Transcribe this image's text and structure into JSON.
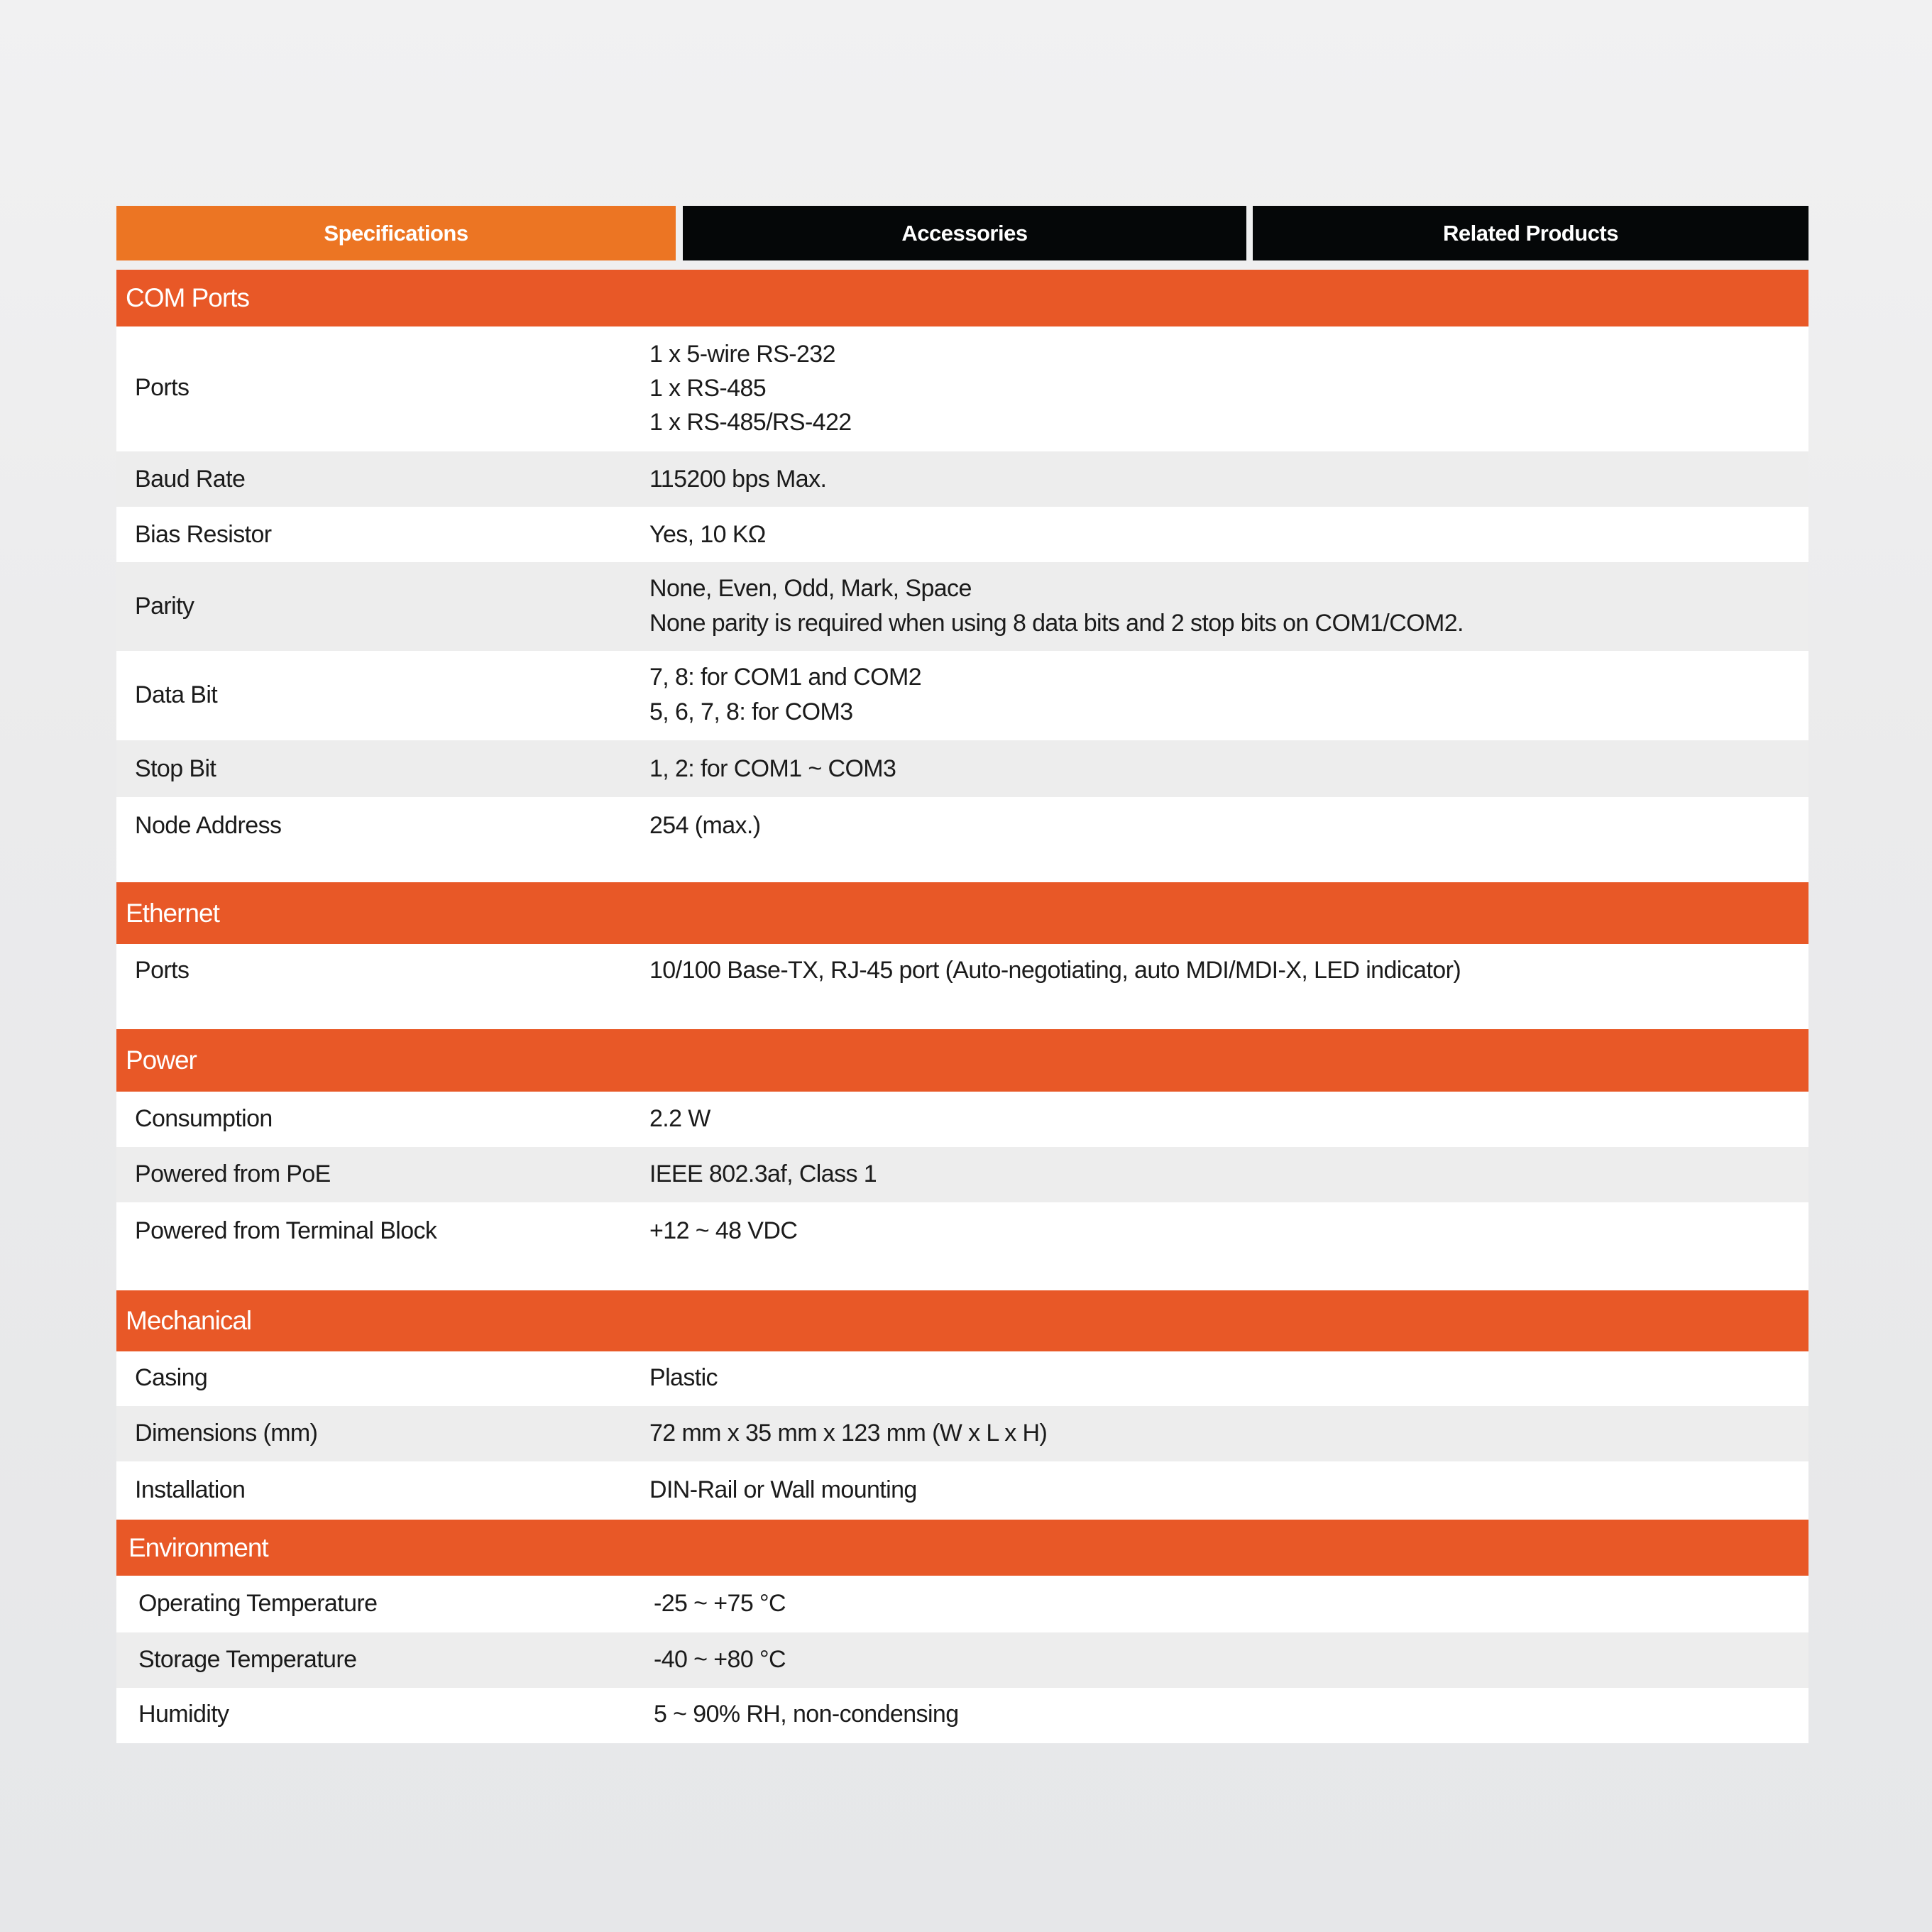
{
  "tabs": [
    {
      "label": "Specifications",
      "active": true
    },
    {
      "label": "Accessories",
      "active": false
    },
    {
      "label": "Related Products",
      "active": false
    }
  ],
  "colors": {
    "active_tab": "#ec7523",
    "inactive_tab": "#050708",
    "section_header": "#e85827",
    "row_alt": "#ededed"
  },
  "sections": {
    "com_ports": {
      "title": "COM Ports",
      "rows": [
        {
          "label": "Ports",
          "value": [
            "1 x 5-wire RS-232",
            "1 x RS-485",
            "1 x RS-485/RS-422"
          ]
        },
        {
          "label": "Baud Rate",
          "value": [
            "115200 bps Max."
          ]
        },
        {
          "label": "Bias Resistor",
          "value": [
            "Yes, 10 KΩ"
          ]
        },
        {
          "label": "Parity",
          "value": [
            "None, Even, Odd, Mark, Space",
            "None parity is required when using 8 data bits and 2 stop bits on COM1/COM2."
          ]
        },
        {
          "label": "Data Bit",
          "value": [
            "7, 8: for COM1 and COM2",
            "5, 6, 7, 8: for COM3"
          ]
        },
        {
          "label": "Stop Bit",
          "value": [
            "1, 2: for COM1 ~ COM3"
          ]
        },
        {
          "label": "Node Address",
          "value": [
            "254 (max.)"
          ]
        }
      ]
    },
    "ethernet": {
      "title": "Ethernet",
      "rows": [
        {
          "label": "Ports",
          "value": [
            "10/100 Base-TX, RJ-45 port (Auto-negotiating, auto MDI/MDI-X, LED indicator)"
          ]
        }
      ]
    },
    "power": {
      "title": "Power",
      "rows": [
        {
          "label": "Consumption",
          "value": [
            "2.2 W"
          ]
        },
        {
          "label": "Powered from PoE",
          "value": [
            "IEEE 802.3af, Class 1"
          ]
        },
        {
          "label": "Powered from Terminal Block",
          "value": [
            "+12 ~ 48 VDC"
          ]
        }
      ]
    },
    "mechanical": {
      "title": "Mechanical",
      "rows": [
        {
          "label": "Casing",
          "value": [
            "Plastic"
          ]
        },
        {
          "label": "Dimensions (mm)",
          "value": [
            "72 mm x 35 mm x 123 mm (W x L x H)"
          ]
        },
        {
          "label": "Installation",
          "value": [
            "DIN-Rail or Wall mounting"
          ]
        }
      ]
    },
    "environment": {
      "title": "Environment",
      "rows": [
        {
          "label": "Operating Temperature",
          "value": [
            "-25 ~ +75 °C"
          ]
        },
        {
          "label": "Storage Temperature",
          "value": [
            "-40 ~ +80 °C"
          ]
        },
        {
          "label": "Humidity",
          "value": [
            "5 ~ 90% RH, non-condensing"
          ]
        }
      ]
    }
  }
}
